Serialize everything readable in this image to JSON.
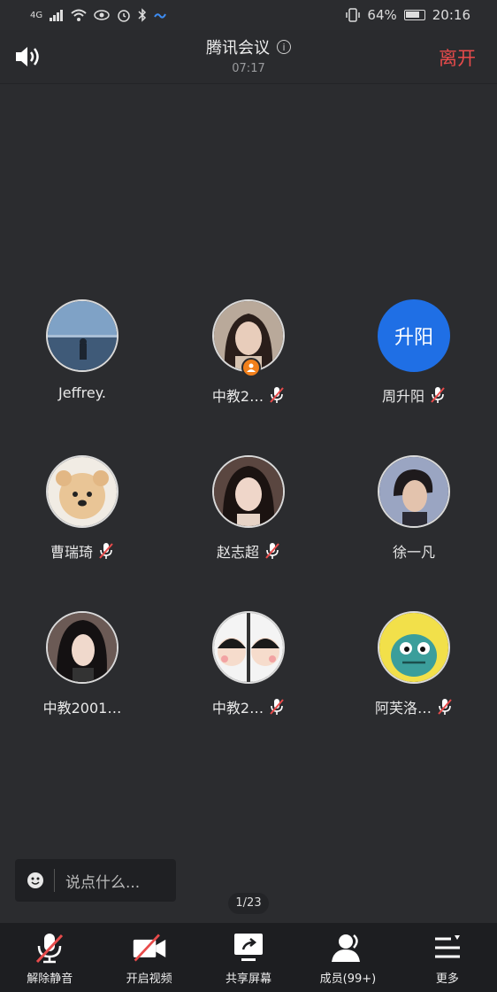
{
  "status_bar": {
    "network": "4G",
    "battery": "64%",
    "battery_level": 0.64,
    "time": "20:16"
  },
  "header": {
    "title": "腾讯会议",
    "timer": "07:17",
    "leave": "离开"
  },
  "participants": [
    {
      "name": "Jeffrey.",
      "muted": false,
      "avatar": "photo-sea"
    },
    {
      "name": "中教2…",
      "muted": true,
      "avatar": "photo-girl",
      "host": true
    },
    {
      "name": "周升阳",
      "muted": true,
      "avatar_text": "升阳"
    },
    {
      "name": "曹瑞琦",
      "muted": true,
      "avatar": "photo-dog"
    },
    {
      "name": "赵志超",
      "muted": true,
      "avatar": "photo-woman"
    },
    {
      "name": "徐一凡",
      "muted": false,
      "avatar": "photo-boy"
    },
    {
      "name": "中教2001…",
      "muted": false,
      "avatar": "cartoon-girl"
    },
    {
      "name": "中教2…",
      "muted": true,
      "avatar": "cartoon-pair"
    },
    {
      "name": "阿芙洛…",
      "muted": true,
      "avatar": "cartoon-dino"
    }
  ],
  "chat": {
    "placeholder": "说点什么..."
  },
  "page_indicator": "1/23",
  "toolbar": [
    {
      "label": "解除静音",
      "icon": "mic-muted-icon"
    },
    {
      "label": "开启视频",
      "icon": "video-off-icon"
    },
    {
      "label": "共享屏幕",
      "icon": "share-screen-icon"
    },
    {
      "label": "成员(99+)",
      "icon": "members-icon"
    },
    {
      "label": "更多",
      "icon": "more-icon"
    }
  ]
}
